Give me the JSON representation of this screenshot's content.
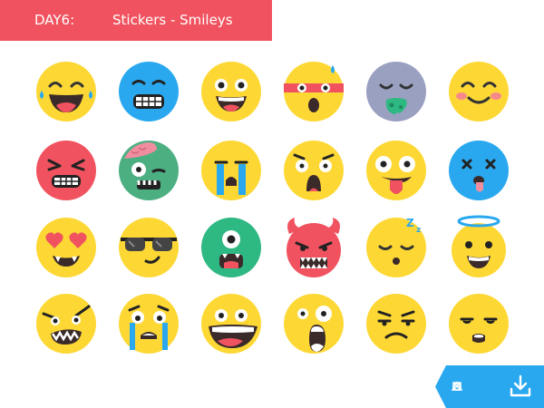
{
  "header": {
    "day_label": "DAY6:",
    "title": "Stickers - Smileys",
    "color": "#f0535f"
  },
  "stickers": [
    {
      "name": "laughing-tears-face-icon",
      "color": "#fdd835"
    },
    {
      "name": "grimacing-cold-face-icon",
      "color": "#29a8ef"
    },
    {
      "name": "grinning-face-icon",
      "color": "#fdd835"
    },
    {
      "name": "headband-sweat-face-icon",
      "color": "#fdd835"
    },
    {
      "name": "vomiting-face-icon",
      "color": "#9aa0c0"
    },
    {
      "name": "blushing-smile-face-icon",
      "color": "#fdd835"
    },
    {
      "name": "angry-red-face-icon",
      "color": "#f0535f"
    },
    {
      "name": "zombie-face-icon",
      "color": "#4caf82"
    },
    {
      "name": "crying-face-icon",
      "color": "#fdd835"
    },
    {
      "name": "shocked-face-icon",
      "color": "#fdd835"
    },
    {
      "name": "tongue-out-face-icon",
      "color": "#fdd835"
    },
    {
      "name": "dizzy-blue-face-icon",
      "color": "#29a8ef"
    },
    {
      "name": "heart-eyes-face-icon",
      "color": "#fdd835"
    },
    {
      "name": "sunglasses-face-icon",
      "color": "#fdd835"
    },
    {
      "name": "cyclops-monster-face-icon",
      "color": "#2eb882"
    },
    {
      "name": "devil-face-icon",
      "color": "#f0535f"
    },
    {
      "name": "sleeping-face-icon",
      "color": "#fdd835"
    },
    {
      "name": "angel-halo-face-icon",
      "color": "#fdd835"
    },
    {
      "name": "frustrated-yelling-face-icon",
      "color": "#fdd835"
    },
    {
      "name": "sobbing-face-icon",
      "color": "#fdd835"
    },
    {
      "name": "big-grin-face-icon",
      "color": "#fdd835"
    },
    {
      "name": "screaming-face-icon",
      "color": "#fdd835"
    },
    {
      "name": "annoyed-face-icon",
      "color": "#fdd835"
    },
    {
      "name": "unamused-face-icon",
      "color": "#fdd835"
    }
  ],
  "download": {
    "icon": "download-icon",
    "badge_icons": [
      "triangle-icon",
      "circle-icon",
      "cross-icon",
      "square-icon"
    ],
    "color": "#29a8ef"
  }
}
